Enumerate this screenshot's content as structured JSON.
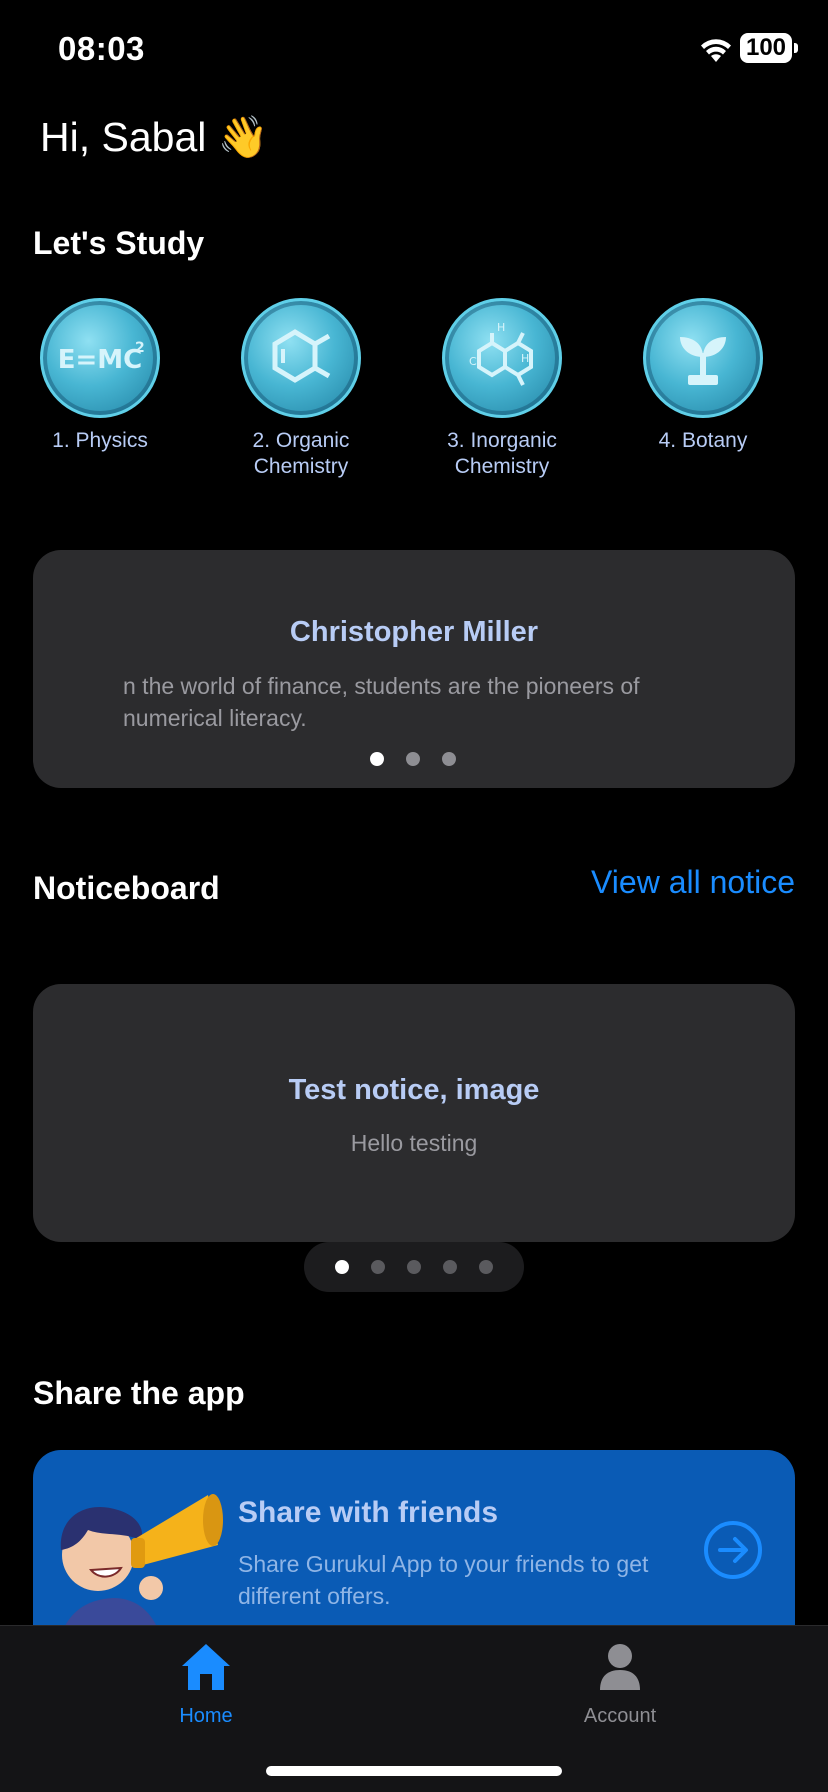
{
  "status": {
    "time": "08:03",
    "battery": "100"
  },
  "greeting": {
    "text": "Hi, Sabal",
    "emoji": "👋"
  },
  "study": {
    "title": "Let's Study",
    "subjects": [
      {
        "label": "1. Physics",
        "icon": "emc2-icon"
      },
      {
        "label": "2. Organic Chemistry",
        "icon": "benzene-ring-icon"
      },
      {
        "label": "3. Inorganic Chemistry",
        "icon": "molecule-icon"
      },
      {
        "label": "4. Botany",
        "icon": "sprout-icon"
      }
    ]
  },
  "quote": {
    "author": "Christopher Miller",
    "text": "n the world of finance, students are the pioneers of numerical literacy.",
    "dots_total": 3,
    "dots_active": 0
  },
  "noticeboard": {
    "title": "Noticeboard",
    "view_all": "View all notice",
    "notice_title": "Test notice, image",
    "notice_body": "Hello testing",
    "dots_total": 5,
    "dots_active": 0
  },
  "share": {
    "section_title": "Share the app",
    "title": "Share with friends",
    "description": "Share Gurukul App to your friends to get different offers."
  },
  "tabs": [
    {
      "label": "Home",
      "icon": "home-icon",
      "active": true
    },
    {
      "label": "Account",
      "icon": "person-icon",
      "active": false
    }
  ],
  "colors": {
    "accent": "#1a8cff",
    "card": "#2c2c2e",
    "share_card": "#0a5bb5",
    "subject_text": "#b8ccf5"
  }
}
